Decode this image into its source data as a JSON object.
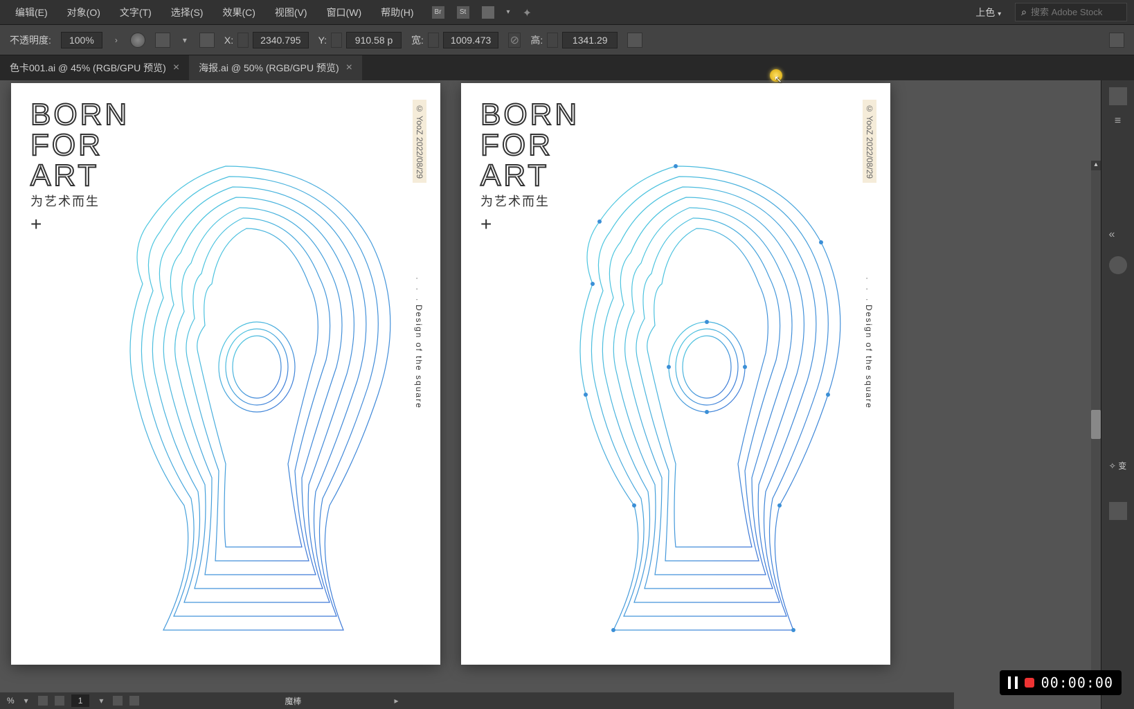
{
  "menu": {
    "edit": "编辑(E)",
    "object": "对象(O)",
    "text": "文字(T)",
    "select": "选择(S)",
    "effect": "效果(C)",
    "view": "视图(V)",
    "window": "窗口(W)",
    "help": "帮助(H)"
  },
  "menu_right": {
    "mode": "上色",
    "search_placeholder": "搜索 Adobe Stock"
  },
  "control": {
    "opacity_label": "不透明度:",
    "opacity_value": "100%",
    "x_label": "X:",
    "x_value": "2340.795",
    "y_label": "Y:",
    "y_value": "910.58 p",
    "w_label": "宽:",
    "w_value": "1009.473",
    "h_label": "高:",
    "h_value": "1341.29"
  },
  "tabs": {
    "t1": "色卡001.ai @ 45% (RGB/GPU 预览)",
    "t2": "海报.ai @ 50% (RGB/GPU 预览)"
  },
  "poster": {
    "line1": "BORN",
    "line2": "FOR",
    "line3": "ART",
    "sub": "为艺术而生",
    "plus": "+",
    "side_top": "© YooZ   2022/08/29",
    "dots": "· · ·",
    "side_mid": "Design of the square"
  },
  "right_panel": {
    "transform": "变"
  },
  "status": {
    "page": "1",
    "tool": "魔棒"
  },
  "recorder": {
    "time": "00:00:00"
  }
}
